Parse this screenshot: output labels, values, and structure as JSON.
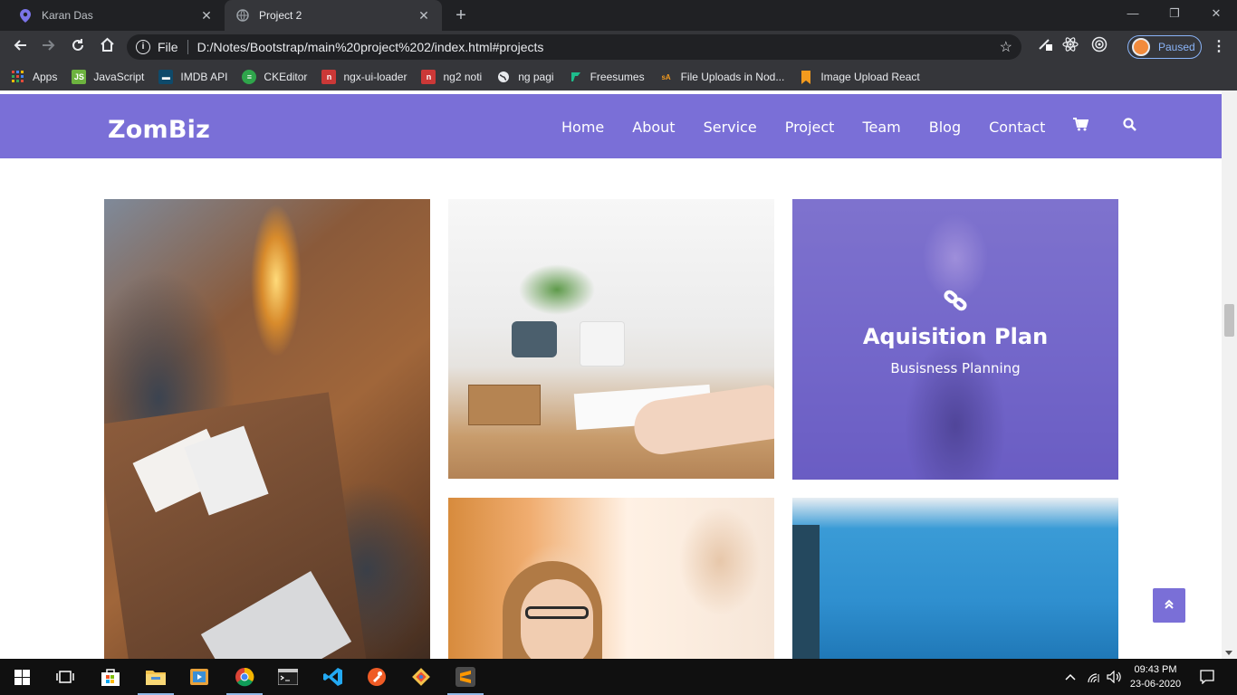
{
  "browser": {
    "tabs": [
      {
        "title": "Karan Das",
        "active": false
      },
      {
        "title": "Project 2",
        "active": true
      }
    ],
    "new_tab_label": "+",
    "window_controls": {
      "minimize": "—",
      "restore": "❐",
      "close": "✕"
    },
    "address": {
      "scheme_label": "File",
      "url": "D:/Notes/Bootstrap/main%20project%202/index.html#projects"
    },
    "profile_status": "Paused",
    "bookmarks": [
      {
        "label": "Apps",
        "icon": "apps-grid-icon",
        "color": "#e34b3b"
      },
      {
        "label": "JavaScript",
        "icon": "javascript-icon",
        "color": "#6db33f"
      },
      {
        "label": "IMDB API",
        "icon": "imdb-icon",
        "color": "#0e4a6b"
      },
      {
        "label": "CKEditor",
        "icon": "ckeditor-icon",
        "color": "#2fa54b"
      },
      {
        "label": "ngx-ui-loader",
        "icon": "npm-icon",
        "color": "#cb3837"
      },
      {
        "label": "ng2 noti",
        "icon": "npm-icon",
        "color": "#cb3837"
      },
      {
        "label": "ng pagi",
        "icon": "globe-icon",
        "color": "#9aa0a6"
      },
      {
        "label": "Freesumes",
        "icon": "freesumes-icon",
        "color": "#1ebc8c"
      },
      {
        "label": "File Uploads in Nod...",
        "icon": "sa-icon",
        "color": "#f29a1e"
      },
      {
        "label": "Image Upload React",
        "icon": "bookmark-icon",
        "color": "#f29a1e"
      }
    ]
  },
  "site": {
    "brand": "ZomBiz",
    "accent": "#7a6fd7",
    "nav": [
      "Home",
      "About",
      "Service",
      "Project",
      "Team",
      "Blog",
      "Contact"
    ],
    "nav_icons": [
      "cart-icon",
      "search-icon"
    ],
    "project_overlay": {
      "title": "Aquisition Plan",
      "subtitle": "Busisness Planning",
      "icon": "link-icon"
    },
    "back_to_top_icon": "double-chevron-up-icon"
  },
  "taskbar": {
    "time": "09:43 PM",
    "date": "23-06-2020",
    "apps": [
      "windows-start-icon",
      "task-view-icon",
      "store-icon",
      "file-explorer-icon",
      "media-player-icon",
      "chrome-icon",
      "terminal-icon",
      "vscode-icon",
      "postman-icon",
      "git-icon",
      "sublime-icon"
    ]
  }
}
